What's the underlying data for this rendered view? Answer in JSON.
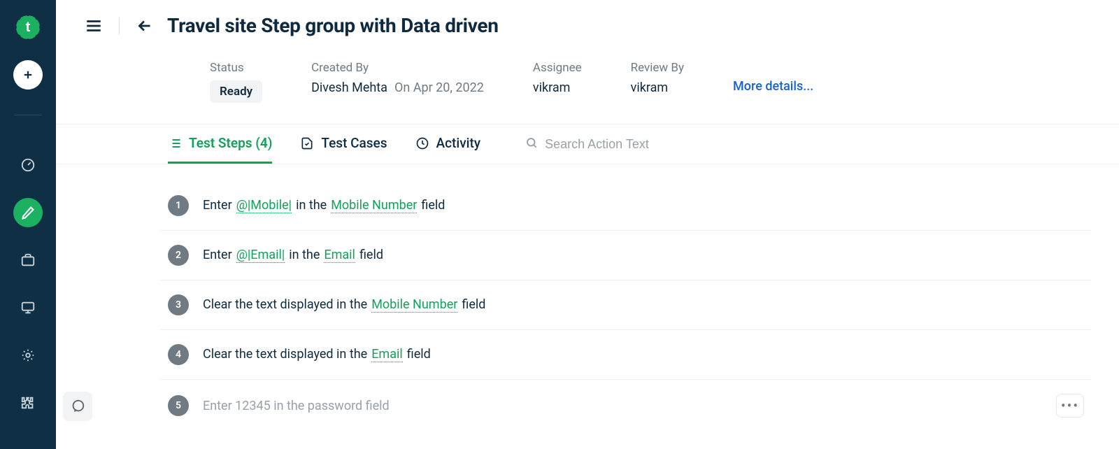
{
  "sidebar": {
    "brand_letter": "t"
  },
  "header": {
    "title": "Travel site Step group with Data driven"
  },
  "meta": {
    "status_label": "Status",
    "status_value": "Ready",
    "created_by_label": "Created By",
    "created_by_value": "Divesh Mehta",
    "created_on": "On Apr 20, 2022",
    "assignee_label": "Assignee",
    "assignee_value": "vikram",
    "review_by_label": "Review By",
    "review_by_value": "vikram",
    "more_details": "More details..."
  },
  "tabs": {
    "test_steps": "Test Steps (4)",
    "test_cases": "Test Cases",
    "activity": "Activity",
    "search_placeholder": "Search Action Text"
  },
  "steps": [
    {
      "num": "1",
      "parts": [
        {
          "t": "plain",
          "v": "Enter"
        },
        {
          "t": "data",
          "v": "@|Mobile|"
        },
        {
          "t": "plain",
          "v": "in the"
        },
        {
          "t": "field",
          "v": "Mobile Number"
        },
        {
          "t": "plain",
          "v": "field"
        }
      ]
    },
    {
      "num": "2",
      "parts": [
        {
          "t": "plain",
          "v": "Enter"
        },
        {
          "t": "data",
          "v": "@|Email|"
        },
        {
          "t": "plain",
          "v": "in the"
        },
        {
          "t": "field",
          "v": "Email"
        },
        {
          "t": "plain",
          "v": "field"
        }
      ]
    },
    {
      "num": "3",
      "parts": [
        {
          "t": "plain",
          "v": "Clear the text displayed in the"
        },
        {
          "t": "field",
          "v": "Mobile Number"
        },
        {
          "t": "plain",
          "v": "field"
        }
      ]
    },
    {
      "num": "4",
      "parts": [
        {
          "t": "plain",
          "v": "Clear the text displayed in the"
        },
        {
          "t": "field",
          "v": "Email"
        },
        {
          "t": "plain",
          "v": "field"
        }
      ]
    }
  ],
  "new_step": {
    "num": "5",
    "placeholder": "Enter 12345 in the password field"
  }
}
